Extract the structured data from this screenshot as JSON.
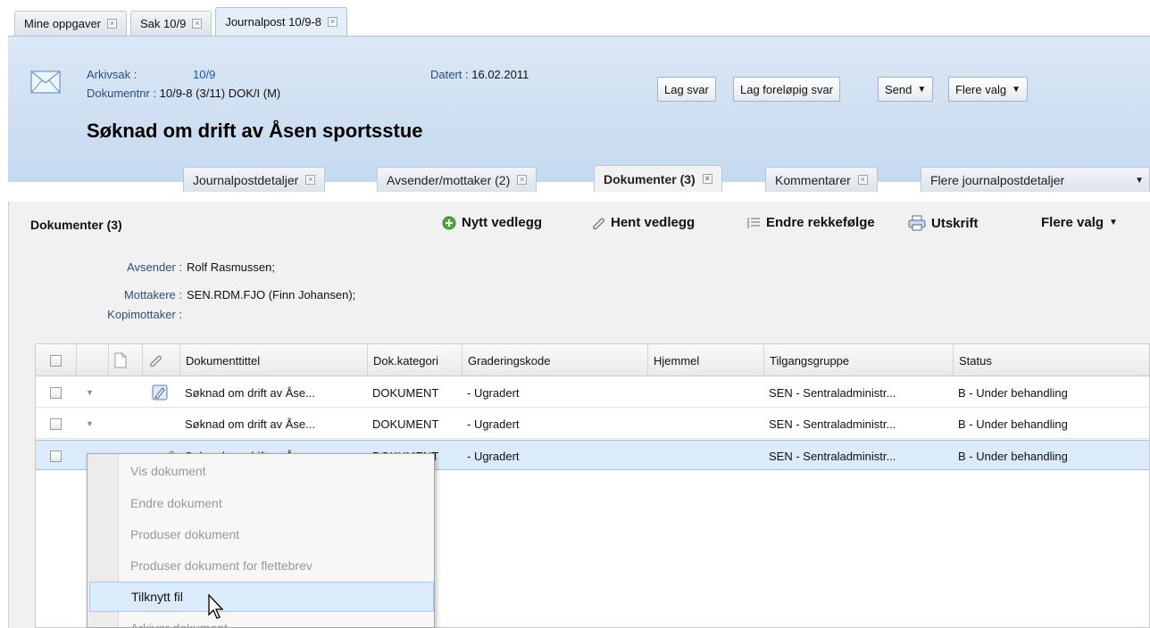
{
  "top_tabs": [
    {
      "label": "Mine oppgaver"
    },
    {
      "label": "Sak 10/9"
    },
    {
      "label": "Journalpost 10/9-8"
    }
  ],
  "header": {
    "arkivsak_label": "Arkivsak :",
    "arkivsak_value": "10/9",
    "dokumentnr_label": "Dokumentnr :",
    "dokumentnr_value": "10/9-8 (3/11) DOK/I (M)",
    "datert_label": "Datert :",
    "datert_value": "16.02.2011",
    "title": "Søknad om drift av Åsen sportsstue",
    "icon": "envelope-icon",
    "buttons": {
      "lag_svar": "Lag svar",
      "lag_forelopig": "Lag foreløpig svar",
      "send": "Send",
      "flere_valg": "Flere valg"
    }
  },
  "detail_tabs": [
    {
      "label": "Journalpostdetaljer"
    },
    {
      "label": "Avsender/mottaker (2)"
    },
    {
      "label": "Dokumenter (3)"
    },
    {
      "label": "Kommentarer"
    },
    {
      "label": "Flere journalpostdetaljer"
    }
  ],
  "content": {
    "title": "Dokumenter (3)",
    "toolbar": {
      "nytt_vedlegg": "Nytt vedlegg",
      "hent_vedlegg": "Hent vedlegg",
      "endre_rekkefolge": "Endre rekkefølge",
      "utskrift": "Utskrift",
      "flere_valg": "Flere valg"
    },
    "parties": {
      "avsender_label": "Avsender :",
      "avsender_value": "Rolf Rasmussen;",
      "mottakere_label": "Mottakere :",
      "mottakere_value": "SEN.RDM.FJO (Finn Johansen);",
      "kopimottaker_label": "Kopimottaker :",
      "kopimottaker_value": ""
    }
  },
  "grid": {
    "columns": [
      "Dokumenttittel",
      "Dok.kategori",
      "Graderingskode",
      "Hjemmel",
      "Tilgangsgruppe",
      "Status"
    ],
    "rows": [
      {
        "tittel": "Søknad om drift av Åse...",
        "kategori": "DOKUMENT",
        "gradering": "- Ugradert",
        "hjemmel": "",
        "tilgang": "SEN - Sentraladministr...",
        "status": "B - Under behandling"
      },
      {
        "tittel": "Søknad om drift av Åse...",
        "kategori": "DOKUMENT",
        "gradering": "- Ugradert",
        "hjemmel": "",
        "tilgang": "SEN - Sentraladministr...",
        "status": "B - Under behandling"
      },
      {
        "tittel": "Søknad om drift av Åse...",
        "kategori": "DOKUMENT",
        "gradering": "- Ugradert",
        "hjemmel": "",
        "tilgang": "SEN - Sentraladministr...",
        "status": "B - Under behandling"
      }
    ]
  },
  "context_menu": {
    "items": [
      {
        "label": "Vis dokument"
      },
      {
        "label": "Endre dokument"
      },
      {
        "label": "Produser dokument"
      },
      {
        "label": "Produser dokument for flettebrev"
      },
      {
        "label": "Tilknytt fil"
      },
      {
        "label": "Arkiver dokument"
      }
    ]
  },
  "colors": {
    "header_bg": "#c5d9ef",
    "selected_row": "#dcebfa",
    "link": "#1a56b0"
  }
}
